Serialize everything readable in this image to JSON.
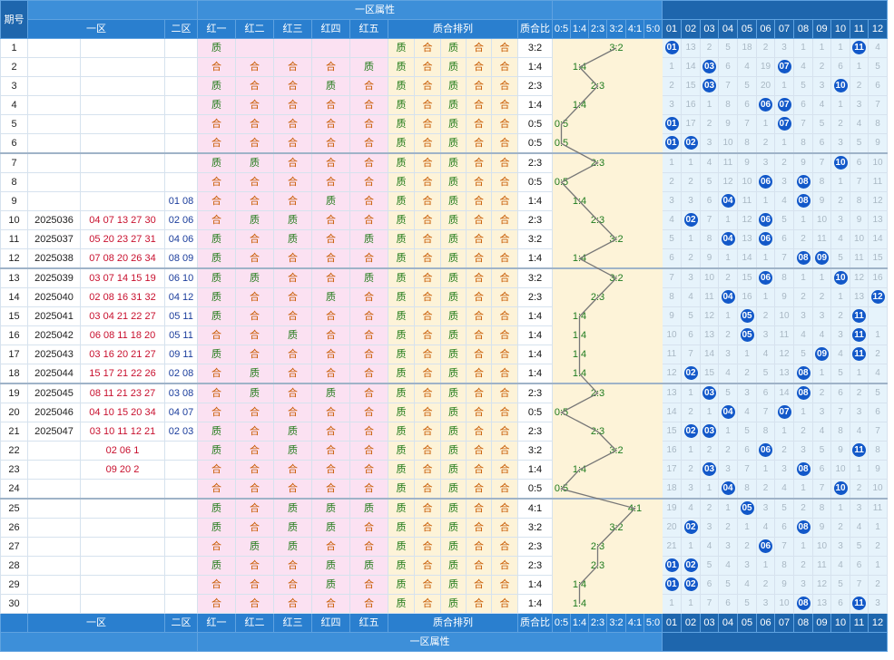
{
  "header": {
    "top_title": "一区属性",
    "bottom_title": "一区属性",
    "col_issue": "期号",
    "col_zone1": "一区",
    "col_zone2": "二区",
    "reds": [
      "红一",
      "红二",
      "红三",
      "红四",
      "红五"
    ],
    "pattern": "质合排列",
    "ratio": "质合比",
    "ratio_cols": [
      "0:5",
      "1:4",
      "2:3",
      "3:2",
      "4:1",
      "5:0"
    ],
    "nums": [
      "01",
      "02",
      "03",
      "04",
      "05",
      "06",
      "07",
      "08",
      "09",
      "10",
      "11",
      "12"
    ]
  },
  "colors": {
    "accent": "#2a7fcf",
    "pink": "#fbe1f2",
    "yellow": "#fdf3d8",
    "blue_zone": "#e6f3fb",
    "ball": "#1258c9"
  },
  "rows": [
    {
      "idx": "1",
      "issue": "",
      "z1": "",
      "z2": "",
      "reds": [
        "质",
        "",
        "",
        "",
        ""
      ],
      "pattern": [
        "质",
        "合",
        "质",
        "合",
        "合"
      ],
      "ratio": "3:2",
      "rk": 3,
      "hits": [
        1,
        11
      ],
      "miss": [
        "",
        "13",
        "2",
        "5",
        "18",
        "2",
        "3",
        "1",
        "1",
        "1",
        "",
        "4"
      ]
    },
    {
      "idx": "2",
      "issue": "",
      "z1": "",
      "z2": "",
      "reds": [
        "合",
        "合",
        "合",
        "合",
        "质"
      ],
      "pattern": [
        "质",
        "合",
        "质",
        "合",
        "合"
      ],
      "ratio": "1:4",
      "rk": 1,
      "hits": [
        3,
        7
      ],
      "miss": [
        "1",
        "14",
        "",
        "6",
        "4",
        "19",
        "",
        "4",
        "2",
        "6",
        "1",
        "5"
      ]
    },
    {
      "idx": "3",
      "issue": "",
      "z1": "",
      "z2": "",
      "reds": [
        "质",
        "合",
        "合",
        "质",
        "合"
      ],
      "pattern": [
        "质",
        "合",
        "质",
        "合",
        "合"
      ],
      "ratio": "2:3",
      "rk": 2,
      "hits": [
        3,
        10
      ],
      "miss": [
        "2",
        "15",
        "",
        "7",
        "5",
        "20",
        "1",
        "5",
        "3",
        "",
        "2",
        "6"
      ]
    },
    {
      "idx": "4",
      "issue": "",
      "z1": "",
      "z2": "",
      "reds": [
        "质",
        "合",
        "合",
        "合",
        "合"
      ],
      "pattern": [
        "质",
        "合",
        "质",
        "合",
        "合"
      ],
      "ratio": "1:4",
      "rk": 1,
      "hits": [
        6,
        7
      ],
      "miss": [
        "3",
        "16",
        "1",
        "8",
        "6",
        "",
        "",
        "6",
        "4",
        "1",
        "3",
        "7"
      ]
    },
    {
      "idx": "5",
      "issue": "",
      "z1": "",
      "z2": "",
      "reds": [
        "合",
        "合",
        "合",
        "合",
        "合"
      ],
      "pattern": [
        "质",
        "合",
        "质",
        "合",
        "合"
      ],
      "ratio": "0:5",
      "rk": 0,
      "hits": [
        1,
        7
      ],
      "miss": [
        "",
        "17",
        "2",
        "9",
        "7",
        "1",
        "",
        "7",
        "5",
        "2",
        "4",
        "8"
      ]
    },
    {
      "idx": "6",
      "issue": "",
      "z1": "",
      "z2": "",
      "reds": [
        "合",
        "合",
        "合",
        "合",
        "合"
      ],
      "pattern": [
        "质",
        "合",
        "质",
        "合",
        "合"
      ],
      "ratio": "0:5",
      "rk": 0,
      "hits": [
        1,
        2
      ],
      "miss": [
        "",
        "",
        "3",
        "10",
        "8",
        "2",
        "1",
        "8",
        "6",
        "3",
        "5",
        "9"
      ]
    },
    {
      "idx": "7",
      "issue": "",
      "z1": "",
      "z2": "",
      "reds": [
        "质",
        "质",
        "合",
        "合",
        "合"
      ],
      "pattern": [
        "质",
        "合",
        "质",
        "合",
        "合"
      ],
      "ratio": "2:3",
      "rk": 2,
      "hits": [
        10
      ],
      "miss": [
        "1",
        "1",
        "4",
        "11",
        "9",
        "3",
        "2",
        "9",
        "7",
        "",
        "6",
        "10"
      ]
    },
    {
      "idx": "8",
      "issue": "",
      "z1": "",
      "z2": "",
      "reds": [
        "合",
        "合",
        "合",
        "合",
        "合"
      ],
      "pattern": [
        "质",
        "合",
        "质",
        "合",
        "合"
      ],
      "ratio": "0:5",
      "rk": 0,
      "hits": [
        6,
        8
      ],
      "miss": [
        "2",
        "2",
        "5",
        "12",
        "10",
        "",
        "3",
        "",
        "8",
        "1",
        "7",
        "11"
      ]
    },
    {
      "idx": "9",
      "issue": "",
      "z1": "",
      "z2": "01 08",
      "reds": [
        "合",
        "合",
        "合",
        "质",
        "合"
      ],
      "pattern": [
        "质",
        "合",
        "质",
        "合",
        "合"
      ],
      "ratio": "1:4",
      "rk": 1,
      "hits": [
        4,
        8
      ],
      "miss": [
        "3",
        "3",
        "6",
        "",
        "11",
        "1",
        "4",
        "",
        "9",
        "2",
        "8",
        "12"
      ]
    },
    {
      "idx": "10",
      "issue": "2025036",
      "z1": "04 07 13 27 30",
      "z2": "02 06",
      "reds": [
        "合",
        "质",
        "质",
        "合",
        "合"
      ],
      "pattern": [
        "质",
        "合",
        "质",
        "合",
        "合"
      ],
      "ratio": "2:3",
      "rk": 2,
      "hits": [
        2,
        6
      ],
      "miss": [
        "4",
        "",
        "7",
        "1",
        "12",
        "",
        "5",
        "1",
        "10",
        "3",
        "9",
        "13"
      ]
    },
    {
      "idx": "11",
      "issue": "2025037",
      "z1": "05 20 23 27 31",
      "z2": "04 06",
      "reds": [
        "质",
        "合",
        "质",
        "合",
        "质"
      ],
      "pattern": [
        "质",
        "合",
        "质",
        "合",
        "合"
      ],
      "ratio": "3:2",
      "rk": 3,
      "hits": [
        4,
        6
      ],
      "miss": [
        "5",
        "1",
        "8",
        "",
        "13",
        "",
        "6",
        "2",
        "11",
        "4",
        "10",
        "14"
      ]
    },
    {
      "idx": "12",
      "issue": "2025038",
      "z1": "07 08 20 26 34",
      "z2": "08 09",
      "reds": [
        "质",
        "合",
        "合",
        "合",
        "合"
      ],
      "pattern": [
        "质",
        "合",
        "质",
        "合",
        "合"
      ],
      "ratio": "1:4",
      "rk": 1,
      "hits": [
        8,
        9
      ],
      "miss": [
        "6",
        "2",
        "9",
        "1",
        "14",
        "1",
        "7",
        "",
        "",
        "5",
        "11",
        "15"
      ]
    },
    {
      "idx": "13",
      "issue": "2025039",
      "z1": "03 07 14 15 19",
      "z2": "06 10",
      "reds": [
        "质",
        "质",
        "合",
        "合",
        "质"
      ],
      "pattern": [
        "质",
        "合",
        "质",
        "合",
        "合"
      ],
      "ratio": "3:2",
      "rk": 3,
      "hits": [
        6,
        10
      ],
      "miss": [
        "7",
        "3",
        "10",
        "2",
        "15",
        "",
        "8",
        "1",
        "1",
        "",
        "12",
        "16"
      ]
    },
    {
      "idx": "14",
      "issue": "2025040",
      "z1": "02 08 16 31 32",
      "z2": "04 12",
      "reds": [
        "质",
        "合",
        "合",
        "质",
        "合"
      ],
      "pattern": [
        "质",
        "合",
        "质",
        "合",
        "合"
      ],
      "ratio": "2:3",
      "rk": 2,
      "hits": [
        4,
        12
      ],
      "miss": [
        "8",
        "4",
        "11",
        "",
        "16",
        "1",
        "9",
        "2",
        "2",
        "1",
        "13",
        ""
      ]
    },
    {
      "idx": "15",
      "issue": "2025041",
      "z1": "03 04 21 22 27",
      "z2": "05 11",
      "reds": [
        "质",
        "合",
        "合",
        "合",
        "合"
      ],
      "pattern": [
        "质",
        "合",
        "质",
        "合",
        "合"
      ],
      "ratio": "1:4",
      "rk": 1,
      "hits": [
        5,
        11
      ],
      "miss": [
        "9",
        "5",
        "12",
        "1",
        "",
        "2",
        "10",
        "3",
        "3",
        "2",
        "",
        ""
      ]
    },
    {
      "idx": "16",
      "issue": "2025042",
      "z1": "06 08 11 18 20",
      "z2": "05 11",
      "reds": [
        "合",
        "合",
        "质",
        "合",
        "合"
      ],
      "pattern": [
        "质",
        "合",
        "质",
        "合",
        "合"
      ],
      "ratio": "1:4",
      "rk": 1,
      "hits": [
        5,
        11
      ],
      "miss": [
        "10",
        "6",
        "13",
        "2",
        "",
        "3",
        "11",
        "4",
        "4",
        "3",
        "",
        "1"
      ]
    },
    {
      "idx": "17",
      "issue": "2025043",
      "z1": "03 16 20 21 27",
      "z2": "09 11",
      "reds": [
        "质",
        "合",
        "合",
        "合",
        "合"
      ],
      "pattern": [
        "质",
        "合",
        "质",
        "合",
        "合"
      ],
      "ratio": "1:4",
      "rk": 1,
      "hits": [
        9,
        11
      ],
      "miss": [
        "11",
        "7",
        "14",
        "3",
        "1",
        "4",
        "12",
        "5",
        "",
        "4",
        "",
        "2"
      ]
    },
    {
      "idx": "18",
      "issue": "2025044",
      "z1": "15 17 21 22 26",
      "z2": "02 08",
      "reds": [
        "合",
        "质",
        "合",
        "合",
        "合"
      ],
      "pattern": [
        "质",
        "合",
        "质",
        "合",
        "合"
      ],
      "ratio": "1:4",
      "rk": 1,
      "hits": [
        2,
        8
      ],
      "miss": [
        "12",
        "",
        "15",
        "4",
        "2",
        "5",
        "13",
        "",
        "1",
        "5",
        "1",
        "4"
      ]
    },
    {
      "idx": "19",
      "issue": "2025045",
      "z1": "08 11 21 23 27",
      "z2": "03 08",
      "reds": [
        "合",
        "质",
        "合",
        "质",
        "合"
      ],
      "pattern": [
        "质",
        "合",
        "质",
        "合",
        "合"
      ],
      "ratio": "2:3",
      "rk": 2,
      "hits": [
        3,
        8
      ],
      "miss": [
        "13",
        "1",
        "",
        "5",
        "3",
        "6",
        "14",
        "",
        "2",
        "6",
        "2",
        "5"
      ]
    },
    {
      "idx": "20",
      "issue": "2025046",
      "z1": "04 10 15 20 34",
      "z2": "04 07",
      "reds": [
        "合",
        "合",
        "合",
        "合",
        "合"
      ],
      "pattern": [
        "质",
        "合",
        "质",
        "合",
        "合"
      ],
      "ratio": "0:5",
      "rk": 0,
      "hits": [
        4,
        7
      ],
      "miss": [
        "14",
        "2",
        "1",
        "",
        "4",
        "7",
        "",
        "1",
        "3",
        "7",
        "3",
        "6"
      ]
    },
    {
      "idx": "21",
      "issue": "2025047",
      "z1": "03 10 11 12 21",
      "z2": "02 03",
      "reds": [
        "质",
        "合",
        "质",
        "合",
        "合"
      ],
      "pattern": [
        "质",
        "合",
        "质",
        "合",
        "合"
      ],
      "ratio": "2:3",
      "rk": 2,
      "hits": [
        2,
        3
      ],
      "miss": [
        "15",
        "",
        "",
        "1",
        "5",
        "8",
        "1",
        "2",
        "4",
        "8",
        "4",
        "7"
      ]
    },
    {
      "idx": "22",
      "issue": "",
      "z1": "02 06 1",
      "z2": "",
      "reds": [
        "质",
        "合",
        "质",
        "合",
        "合"
      ],
      "pattern": [
        "质",
        "合",
        "质",
        "合",
        "合"
      ],
      "ratio": "3:2",
      "rk": 3,
      "hits": [
        6,
        11
      ],
      "miss": [
        "16",
        "1",
        "2",
        "2",
        "6",
        "",
        "2",
        "3",
        "5",
        "9",
        "",
        "8"
      ]
    },
    {
      "idx": "23",
      "issue": "",
      "z1": "09 20 2",
      "z2": "",
      "reds": [
        "合",
        "合",
        "合",
        "合",
        "合"
      ],
      "pattern": [
        "质",
        "合",
        "质",
        "合",
        "合"
      ],
      "ratio": "1:4",
      "rk": 1,
      "hits": [
        3,
        8
      ],
      "miss": [
        "17",
        "2",
        "",
        "3",
        "7",
        "1",
        "3",
        "",
        "6",
        "10",
        "1",
        "9"
      ]
    },
    {
      "idx": "24",
      "issue": "",
      "z1": "",
      "z2": "",
      "reds": [
        "合",
        "合",
        "合",
        "合",
        "合"
      ],
      "pattern": [
        "质",
        "合",
        "质",
        "合",
        "合"
      ],
      "ratio": "0:5",
      "rk": 0,
      "hits": [
        4,
        10
      ],
      "miss": [
        "18",
        "3",
        "1",
        "",
        "8",
        "2",
        "4",
        "1",
        "7",
        "",
        "2",
        "10"
      ]
    },
    {
      "idx": "25",
      "issue": "",
      "z1": "",
      "z2": "",
      "reds": [
        "质",
        "合",
        "质",
        "质",
        "质"
      ],
      "pattern": [
        "质",
        "合",
        "质",
        "合",
        "合"
      ],
      "ratio": "4:1",
      "rk": 4,
      "hits": [
        5
      ],
      "miss": [
        "19",
        "4",
        "2",
        "1",
        "",
        "3",
        "5",
        "2",
        "8",
        "1",
        "3",
        "11"
      ]
    },
    {
      "idx": "26",
      "issue": "",
      "z1": "",
      "z2": "",
      "reds": [
        "质",
        "合",
        "质",
        "质",
        "合"
      ],
      "pattern": [
        "质",
        "合",
        "质",
        "合",
        "合"
      ],
      "ratio": "3:2",
      "rk": 3,
      "hits": [
        2,
        8
      ],
      "miss": [
        "20",
        "",
        "3",
        "2",
        "1",
        "4",
        "6",
        "",
        "9",
        "2",
        "4",
        "1"
      ]
    },
    {
      "idx": "27",
      "issue": "",
      "z1": "",
      "z2": "",
      "reds": [
        "合",
        "质",
        "质",
        "合",
        "合"
      ],
      "pattern": [
        "质",
        "合",
        "质",
        "合",
        "合"
      ],
      "ratio": "2:3",
      "rk": 2,
      "hits": [
        6
      ],
      "miss": [
        "21",
        "1",
        "4",
        "3",
        "2",
        "",
        "7",
        "1",
        "10",
        "3",
        "5",
        "2"
      ]
    },
    {
      "idx": "28",
      "issue": "",
      "z1": "",
      "z2": "",
      "reds": [
        "质",
        "合",
        "合",
        "质",
        "质"
      ],
      "pattern": [
        "质",
        "合",
        "质",
        "合",
        "合"
      ],
      "ratio": "2:3",
      "rk": 2,
      "hits": [
        1,
        2
      ],
      "miss": [
        "",
        "",
        "5",
        "4",
        "3",
        "1",
        "8",
        "2",
        "11",
        "4",
        "6",
        "1"
      ]
    },
    {
      "idx": "29",
      "issue": "",
      "z1": "",
      "z2": "",
      "reds": [
        "合",
        "合",
        "合",
        "质",
        "合"
      ],
      "pattern": [
        "质",
        "合",
        "质",
        "合",
        "合"
      ],
      "ratio": "1:4",
      "rk": 1,
      "hits": [
        1,
        2
      ],
      "miss": [
        "",
        "",
        "6",
        "5",
        "4",
        "2",
        "9",
        "3",
        "12",
        "5",
        "7",
        "2"
      ]
    },
    {
      "idx": "30",
      "issue": "",
      "z1": "",
      "z2": "",
      "reds": [
        "合",
        "合",
        "合",
        "合",
        "合"
      ],
      "pattern": [
        "质",
        "合",
        "质",
        "合",
        "合"
      ],
      "ratio": "1:4",
      "rk": 1,
      "hits": [
        8,
        11
      ],
      "miss": [
        "1",
        "1",
        "7",
        "6",
        "5",
        "3",
        "10",
        "",
        "13",
        "6",
        "",
        "3"
      ]
    }
  ]
}
